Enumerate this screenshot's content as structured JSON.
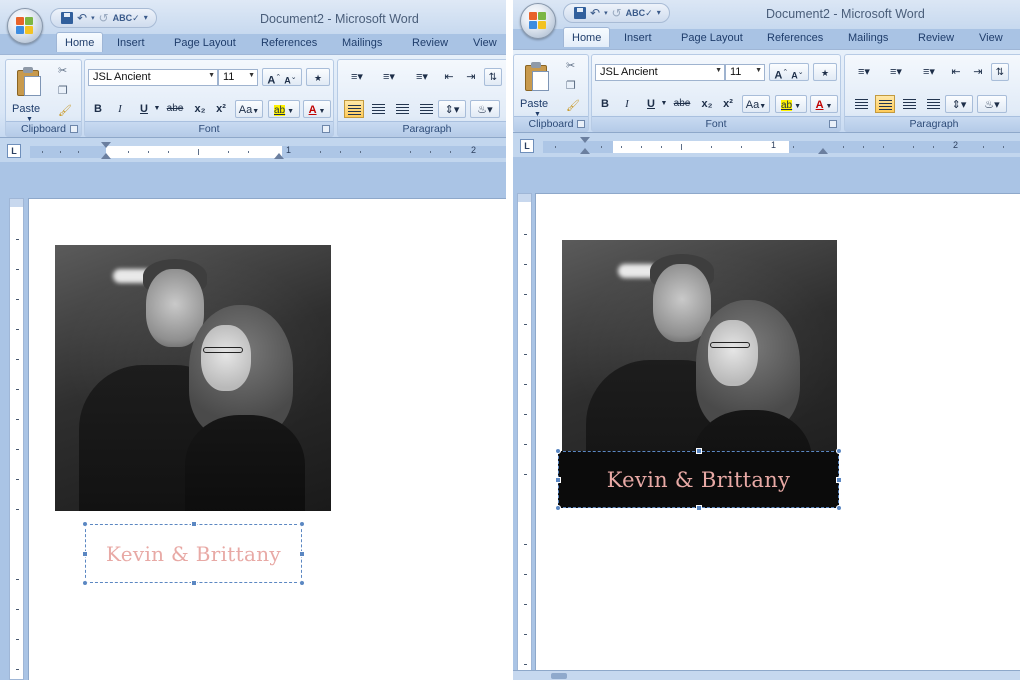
{
  "window": {
    "title": "Document2 - Microsoft Word"
  },
  "tabs": [
    "Home",
    "Insert",
    "Page Layout",
    "References",
    "Mailings",
    "Review",
    "View"
  ],
  "clipboard": {
    "paste_label": "Paste",
    "group_label": "Clipboard"
  },
  "font": {
    "font_name": "JSL Ancient",
    "font_size": "11",
    "grow_label": "A",
    "shrink_label": "A",
    "bold": "B",
    "italic": "I",
    "underline": "U",
    "strikethrough": "abe",
    "subscript": "x₂",
    "superscript": "x²",
    "change_case": "Aa",
    "highlight": "ab",
    "font_color": "A",
    "group_label": "Font"
  },
  "paragraph": {
    "group_label": "Paragraph"
  },
  "ruler": {
    "corner": "L",
    "marks": [
      "1",
      "2"
    ]
  },
  "document": {
    "caption": "Kevin & Brittany"
  },
  "colors": {
    "caption": "#e8a9a5",
    "ribbon": "#dbe7f6",
    "selection": "#5b87c2"
  },
  "icons": [
    "office-button-icon",
    "save-icon",
    "undo-icon",
    "redo-icon",
    "spelling-icon",
    "cut-icon",
    "copy-icon",
    "format-painter-icon",
    "bullets-icon",
    "numbering-icon",
    "multilevel-list-icon",
    "decrease-indent-icon",
    "increase-indent-icon",
    "sort-icon",
    "align-left-icon",
    "center-icon",
    "align-right-icon",
    "justify-icon",
    "line-spacing-icon",
    "shading-icon"
  ]
}
